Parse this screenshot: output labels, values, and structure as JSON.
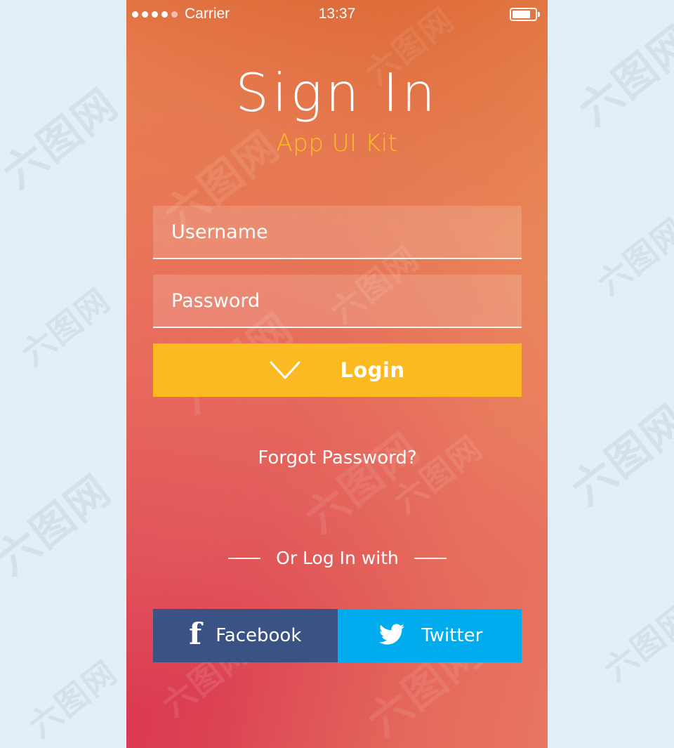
{
  "background": {
    "page_color": "#e3eff7",
    "watermark_text": "六图网"
  },
  "phone": {
    "gradient": {
      "top_left": "#ef9063",
      "top_right": "#d5551f",
      "mid_left": "#e8655c",
      "bottom_left": "#d4214d",
      "bottom_right": "#e88a62"
    }
  },
  "status_bar": {
    "signal_dots": 5,
    "signal_filled": 4,
    "carrier": "Carrier",
    "time": "13:37",
    "battery_percent": 82
  },
  "header": {
    "title": "Sign  In",
    "subtitle": "App UI Kit",
    "title_color": "#ffffff",
    "subtitle_color": "#f9c125"
  },
  "form": {
    "fields": [
      {
        "name": "username",
        "placeholder": "Username",
        "value": ""
      },
      {
        "name": "password",
        "placeholder": "Password",
        "value": ""
      }
    ],
    "login_button": {
      "label": "Login",
      "icon": "checkmark-icon",
      "color": "#fbba21"
    },
    "forgot_password": "Forgot Password?"
  },
  "social": {
    "divider_text": "Or Log In with",
    "buttons": [
      {
        "name": "facebook",
        "label": "Facebook",
        "icon": "facebook-icon",
        "color": "#3b5284"
      },
      {
        "name": "twitter",
        "label": "Twitter",
        "icon": "twitter-icon",
        "color": "#00acee"
      }
    ]
  }
}
